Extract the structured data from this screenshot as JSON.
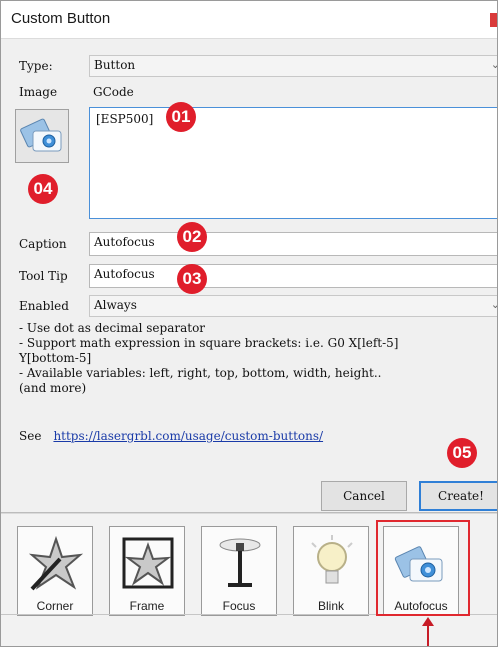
{
  "window": {
    "title": "Custom Button"
  },
  "form": {
    "type_label": "Type:",
    "type_value": "Button",
    "image_label": "Image",
    "gcode_label": "GCode",
    "gcode_value": "[ESP500]",
    "caption_label": "Caption",
    "caption_value": "Autofocus",
    "tooltip_label": "Tool Tip",
    "tooltip_value": "Autofocus",
    "enabled_label": "Enabled",
    "enabled_value": "Always"
  },
  "help": {
    "text": "- Use dot as decimal separator\n- Support math expression in square brackets: i.e. G0 X[left-5]\nY[bottom-5]\n- Available variables: left, right, top, bottom, width, height..\n(and more)",
    "see_label": "See",
    "link": "https://lasergrbl.com/usage/custom-buttons/"
  },
  "buttons": {
    "cancel": "Cancel",
    "create": "Create!"
  },
  "toolbar": {
    "items": [
      {
        "label": "Corner",
        "icon": "corner-icon"
      },
      {
        "label": "Frame",
        "icon": "frame-icon"
      },
      {
        "label": "Focus",
        "icon": "focus-icon"
      },
      {
        "label": "Blink",
        "icon": "blink-icon"
      },
      {
        "label": "Autofocus",
        "icon": "autofocus-icon"
      }
    ]
  },
  "annotations": {
    "b1": "01",
    "b2": "02",
    "b3": "03",
    "b4": "04",
    "b5": "05"
  },
  "colors": {
    "badge": "#e01e2b",
    "highlight": "#e0282f",
    "link": "#1a3ba8",
    "default_button_border": "#2f7fd6"
  }
}
